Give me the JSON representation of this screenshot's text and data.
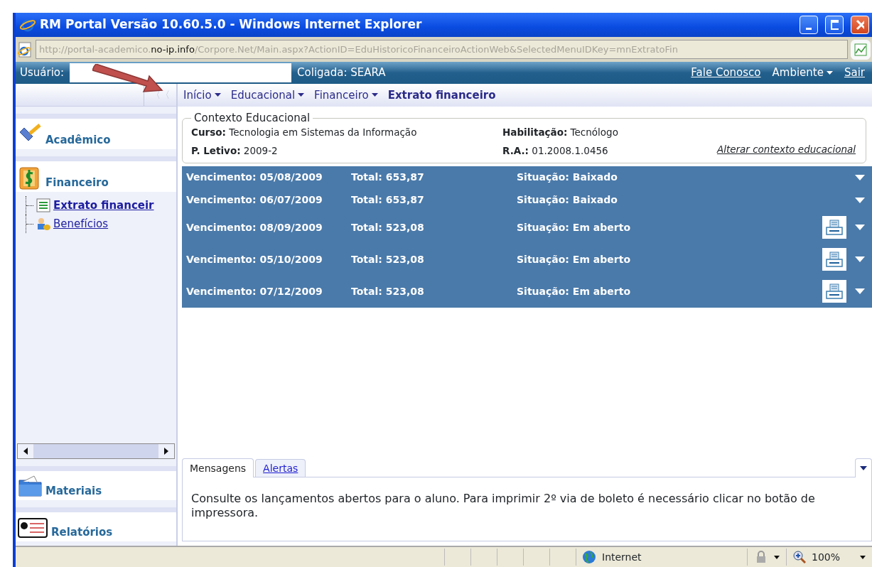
{
  "window": {
    "title": "RM Portal Versão 10.60.5.0 - Windows Internet Explorer"
  },
  "address_bar": {
    "scheme": "http:",
    "host_pre": "//portal-academico.",
    "host": "no-ip.info",
    "path": "/Corpore.Net/Main.aspx?ActionID=EduHistoricoFinanceiroActionWeb&SelectedMenuIDKey=mnExtratoFin"
  },
  "user_bar": {
    "user_label": "Usuário:",
    "coligada": "Coligada: SEARA",
    "links": [
      {
        "label": "Fale Conosco",
        "kind": "link"
      },
      {
        "label": "Ambiente",
        "kind": "menu"
      },
      {
        "label": "Sair",
        "kind": "link"
      }
    ]
  },
  "sidebar": {
    "collapse": "〈〈",
    "sections": [
      {
        "label": "Acadêmico"
      },
      {
        "label": "Financeiro",
        "children": [
          {
            "label": "Extrato financeir",
            "selected": true
          },
          {
            "label": "Benefícios",
            "selected": false
          }
        ]
      }
    ],
    "bottom_sections": [
      {
        "label": "Materiais"
      },
      {
        "label": "Relatórios"
      }
    ]
  },
  "breadcrumb": [
    {
      "label": "Início",
      "kind": "menu"
    },
    {
      "label": "Educacional",
      "kind": "menu"
    },
    {
      "label": "Financeiro",
      "kind": "menu"
    },
    {
      "label": "Extrato financeiro",
      "kind": "current"
    }
  ],
  "context": {
    "title": "Contexto Educacional",
    "fields": [
      {
        "text": "**Curso:** Tecnologia em Sistemas da Informação"
      },
      {
        "text": "**Habilitação:** Tecnólogo"
      },
      {
        "text": "**P. Letivo:** 2009-2"
      },
      {
        "text": "**R.A.:** 01.2008.1.0456"
      }
    ],
    "link": "Alterar contexto educacional"
  },
  "rows": [
    {
      "due": "Vencimento: 05/08/2009",
      "total": "Total: 653,87",
      "status": "Situação: Baixado",
      "printable": false
    },
    {
      "due": "Vencimento: 06/07/2009",
      "total": "Total: 653,87",
      "status": "Situação: Baixado",
      "printable": false
    },
    {
      "due": "Vencimento: 08/09/2009",
      "total": "Total: 523,08",
      "status": "Situação: Em aberto",
      "printable": true
    },
    {
      "due": "Vencimento: 05/10/2009",
      "total": "Total: 523,08",
      "status": "Situação: Em aberto",
      "printable": true
    },
    {
      "due": "Vencimento: 07/12/2009",
      "total": "Total: 523,08",
      "status": "Situação: Em aberto",
      "printable": true
    }
  ],
  "messages": {
    "tabs": [
      {
        "label": "Mensagens",
        "selected": true
      },
      {
        "label": "Alertas",
        "selected": false
      }
    ],
    "text": "Consulte os lançamentos abertos para o aluno. Para imprimir 2º via de boleto é necessário clicar no botão de impressora."
  },
  "status_bar": {
    "zone": "Internet",
    "zoom": "100%"
  }
}
